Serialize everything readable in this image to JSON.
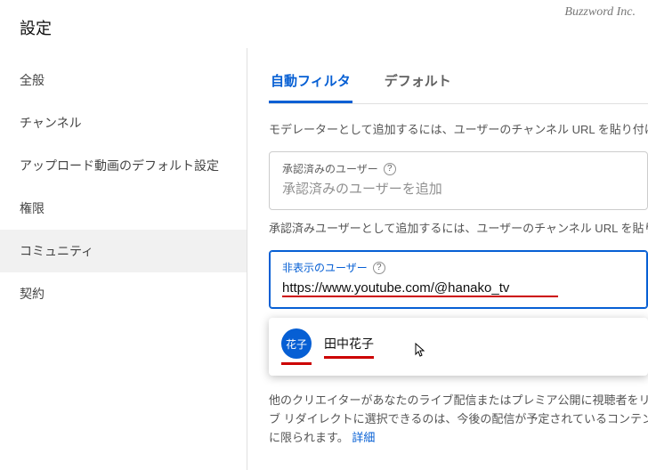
{
  "brand": "Buzzword Inc.",
  "page_title": "設定",
  "sidebar": {
    "items": [
      {
        "label": "全般"
      },
      {
        "label": "チャンネル"
      },
      {
        "label": "アップロード動画のデフォルト設定"
      },
      {
        "label": "権限"
      },
      {
        "label": "コミュニティ"
      },
      {
        "label": "契約"
      }
    ],
    "active_index": 4
  },
  "tabs": {
    "items": [
      {
        "label": "自動フィルタ"
      },
      {
        "label": "デフォルト"
      }
    ],
    "active_index": 0
  },
  "moderator_hint": "モデレーターとして追加するには、ユーザーのチャンネル URL を貼り付けます",
  "approved": {
    "label": "承認済みのユーザー",
    "placeholder": "承認済みのユーザーを追加",
    "hint": "承認済みユーザーとして追加するには、ユーザーのチャンネル URL を貼り付け"
  },
  "hidden": {
    "label": "非表示のユーザー",
    "value": "https://www.youtube.com/@hanako_tv"
  },
  "suggestion": {
    "avatar_text": "花子",
    "name": "田中花子"
  },
  "description": {
    "line1": "他のクリエイターがあなたのライブ配信またはプレミア公開に視聴者をリダイレ",
    "line2_a": "ブ リダイレクトに選択できるのは、今後の配信が予定されているコンテンツ、",
    "line2_b": "に限られます。",
    "link": "詳細"
  }
}
